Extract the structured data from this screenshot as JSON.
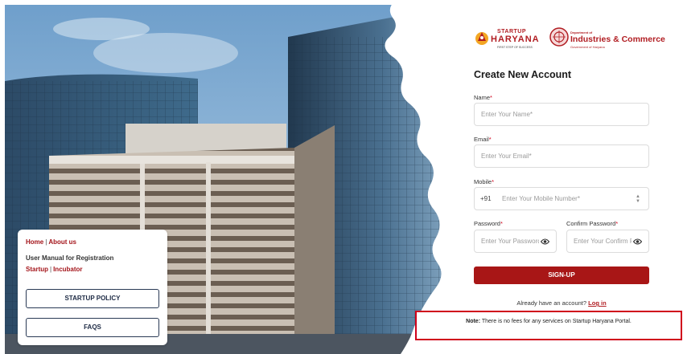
{
  "links": {
    "home": "Home",
    "about": "About us",
    "manual": "User Manual for Registration",
    "startup": "Startup",
    "incubator": "Incubator",
    "separator": "|"
  },
  "buttons": {
    "startup_policy": "STARTUP POLICY",
    "faqs": "FAQS",
    "signup": "SIGN-UP"
  },
  "logos": {
    "startup_top": "STARTUP",
    "startup_main": "HARYANA",
    "startup_tag": "FIRST STEP OF SUCCESS",
    "dept_small": "Department of",
    "dept_main": "Industries & Commerce",
    "dept_sub": "Government of Haryana"
  },
  "form": {
    "title": "Create New Account",
    "required_mark": "*",
    "name_label": "Name",
    "name_placeholder": "Enter Your Name*",
    "email_label": "Email",
    "email_placeholder": "Enter Your Email*",
    "mobile_label": "Mobile",
    "country_code": "+91",
    "mobile_placeholder": "Enter Your Mobile Number*",
    "password_label": "Password",
    "password_placeholder": "Enter Your Password*",
    "confirm_label": "Confirm Password",
    "confirm_placeholder": "Enter Your Confirm Password*",
    "already_text": "Already have an account?",
    "login_link": "Log in"
  },
  "note": {
    "label": "Note:",
    "text": "There is no fees for any services on Startup Haryana Portal."
  },
  "colors": {
    "brand_red": "#a81616",
    "note_border": "#d0021b",
    "sky": "#8fb8d9"
  }
}
